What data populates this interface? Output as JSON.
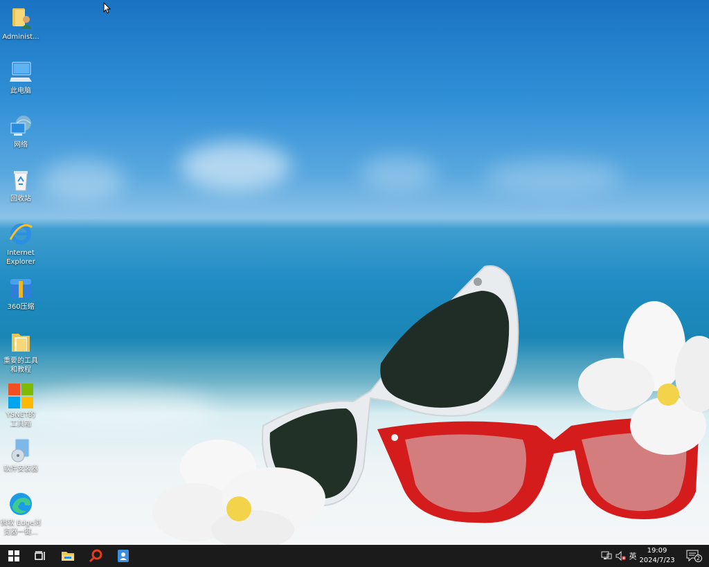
{
  "desktop": {
    "icons": [
      {
        "label": "Administ...",
        "icon": "user-folder-icon"
      },
      {
        "label": "此电脑",
        "icon": "this-pc-icon"
      },
      {
        "label": "网络",
        "icon": "network-icon"
      },
      {
        "label": "回收站",
        "icon": "recycle-bin-icon"
      },
      {
        "label": "Internet\nExplorer",
        "icon": "internet-explorer-icon"
      },
      {
        "label": "360压缩",
        "icon": "360-zip-icon"
      },
      {
        "label": "重要的工具\n和教程",
        "icon": "folder-icon"
      },
      {
        "label": "YSNET的\n工具箱",
        "icon": "toolbox-icon"
      },
      {
        "label": "软件安装器",
        "icon": "installer-icon"
      },
      {
        "label": "微软 Edge浏\n览器一键...",
        "icon": "edge-icon"
      }
    ]
  },
  "taskbar": {
    "pinned": [
      {
        "icon": "windows-start-icon"
      },
      {
        "icon": "task-view-icon"
      },
      {
        "icon": "file-explorer-icon"
      },
      {
        "icon": "search-tool-icon"
      },
      {
        "icon": "contacts-app-icon"
      }
    ],
    "tray": {
      "input_method": "英",
      "time": "19:09",
      "date": "2024/7/23",
      "notification_count": "2"
    }
  },
  "colors": {
    "taskbar_bg": "#1b1b1c",
    "accent_red": "#d41c1c"
  }
}
